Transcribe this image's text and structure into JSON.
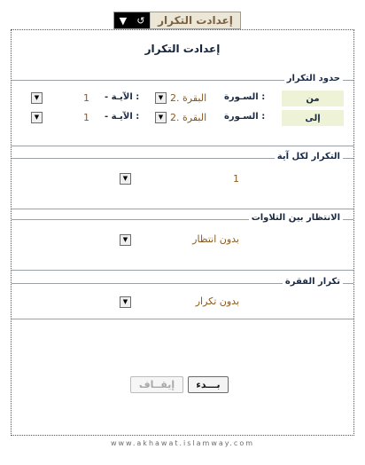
{
  "tab": {
    "title": "إعدادت التكرار"
  },
  "panel": {
    "title": "إعدادت التكرار"
  },
  "range": {
    "section_label": "حدود التكرار",
    "rows": [
      {
        "label": "من",
        "sura_word": "السـورة :",
        "sura_value": "2. البقرة",
        "aya_word": "- الآيـة :",
        "aya_value": "1"
      },
      {
        "label": "إلى",
        "sura_word": "السـورة :",
        "sura_value": "2. البقرة",
        "aya_word": "- الآيـة :",
        "aya_value": "1"
      }
    ]
  },
  "repeat_each": {
    "section_label": "التكرار لكل آية",
    "value": "1"
  },
  "wait": {
    "section_label": "الانتظار بين التلاوات",
    "value": "بدون انتظار"
  },
  "paragraph": {
    "section_label": "تكرار الفقرة",
    "value": "بدون تكرار"
  },
  "buttons": {
    "start": "بـــدء",
    "stop": "إيقــاف"
  },
  "footer": "www.akhawat.islamway.com"
}
